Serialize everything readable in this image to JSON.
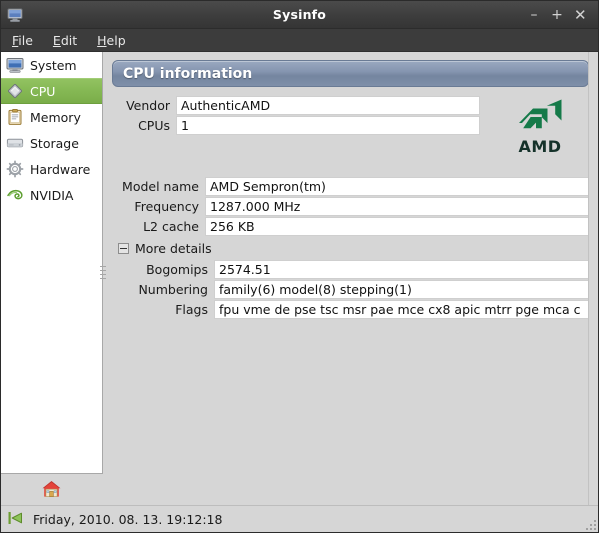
{
  "window": {
    "title": "Sysinfo",
    "app_icon": "computer-monitor-icon",
    "controls": {
      "minimize": "–",
      "maximize": "+",
      "close": "✕"
    }
  },
  "menubar": {
    "items": [
      {
        "label": "File",
        "mnemonic": "F"
      },
      {
        "label": "Edit",
        "mnemonic": "E"
      },
      {
        "label": "Help",
        "mnemonic": "H"
      }
    ]
  },
  "sidebar": {
    "items": [
      {
        "label": "System",
        "icon": "computer-monitor-icon",
        "selected": false
      },
      {
        "label": "CPU",
        "icon": "cpu-chip-icon",
        "selected": true
      },
      {
        "label": "Memory",
        "icon": "clipboard-icon",
        "selected": false
      },
      {
        "label": "Storage",
        "icon": "hard-disk-icon",
        "selected": false
      },
      {
        "label": "Hardware",
        "icon": "gear-icon",
        "selected": false
      },
      {
        "label": "NVIDIA",
        "icon": "nvidia-eye-icon",
        "selected": false
      }
    ],
    "toolbar": {
      "home_icon": "home-icon"
    }
  },
  "content": {
    "header": "CPU information",
    "logo": {
      "brand": "AMD",
      "mark": "amd-arrow-logo",
      "color": "#157a49"
    },
    "top_fields": [
      {
        "label": "Vendor",
        "value": "AuthenticAMD"
      },
      {
        "label": "CPUs",
        "value": "1"
      }
    ],
    "main_fields": [
      {
        "label": "Model name",
        "value": "AMD Sempron(tm)"
      },
      {
        "label": "Frequency",
        "value": "1287.000 MHz"
      },
      {
        "label": "L2 cache",
        "value": "256 KB"
      }
    ],
    "expander": {
      "label": "More details",
      "expanded": true,
      "sign": "−"
    },
    "detail_fields": [
      {
        "label": "Bogomips",
        "value": "2574.51"
      },
      {
        "label": "Numbering",
        "value": "family(6) model(8) stepping(1)"
      },
      {
        "label": "Flags",
        "value": "fpu vme de pse tsc msr pae mce cx8 apic mtrr pge mca c"
      }
    ]
  },
  "statusbar": {
    "icon": "go-previous-icon",
    "text": "Friday, 2010. 08. 13. 19:12:18"
  },
  "colors": {
    "titlebar": "#3e3e3e",
    "menubar": "#3c3c3c",
    "window_bg": "#d6d6d6",
    "selection_green": "#86b955",
    "header_blue": "#8595b0",
    "amd_green": "#157a49"
  }
}
